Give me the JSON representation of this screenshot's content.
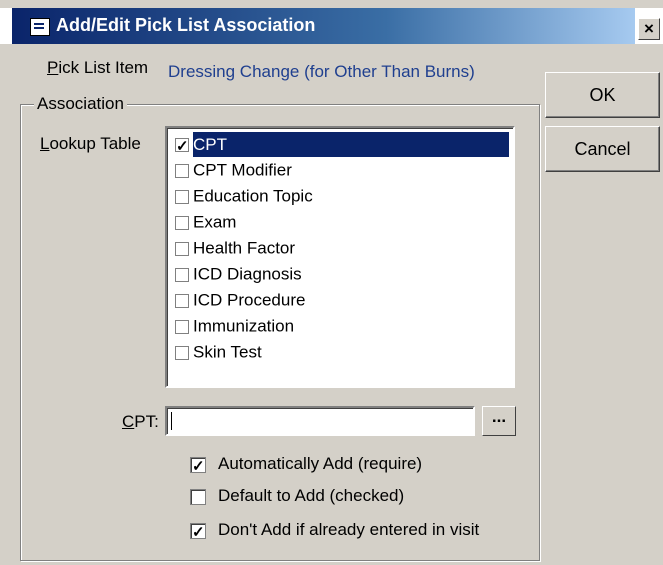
{
  "window": {
    "title": "Add/Edit Pick List Association",
    "close_label": "×"
  },
  "pick_list": {
    "label": "Pick List Item",
    "value": "Dressing Change (for Other Than Burns)"
  },
  "association": {
    "group_label": "Association",
    "lookup_label": "Lookup Table",
    "items": [
      {
        "label": "CPT",
        "checked": true,
        "selected": true
      },
      {
        "label": "CPT Modifier",
        "checked": false,
        "selected": false
      },
      {
        "label": "Education Topic",
        "checked": false,
        "selected": false
      },
      {
        "label": "Exam",
        "checked": false,
        "selected": false
      },
      {
        "label": "Health Factor",
        "checked": false,
        "selected": false
      },
      {
        "label": "ICD Diagnosis",
        "checked": false,
        "selected": false
      },
      {
        "label": "ICD Procedure",
        "checked": false,
        "selected": false
      },
      {
        "label": "Immunization",
        "checked": false,
        "selected": false
      },
      {
        "label": "Skin Test",
        "checked": false,
        "selected": false
      }
    ],
    "code_label": "CPT:",
    "code_value": "",
    "browse_label": "..."
  },
  "options": [
    {
      "label": "Automatically Add (require)",
      "checked": true
    },
    {
      "label": "Default to Add (checked)",
      "checked": false
    },
    {
      "label": "Don't Add if already entered in visit",
      "checked": true
    }
  ],
  "buttons": {
    "ok": "OK",
    "cancel": "Cancel"
  },
  "colors": {
    "title_bar": "#0a246a",
    "selection": "#0a246a",
    "value_text": "#1f3f8f"
  }
}
